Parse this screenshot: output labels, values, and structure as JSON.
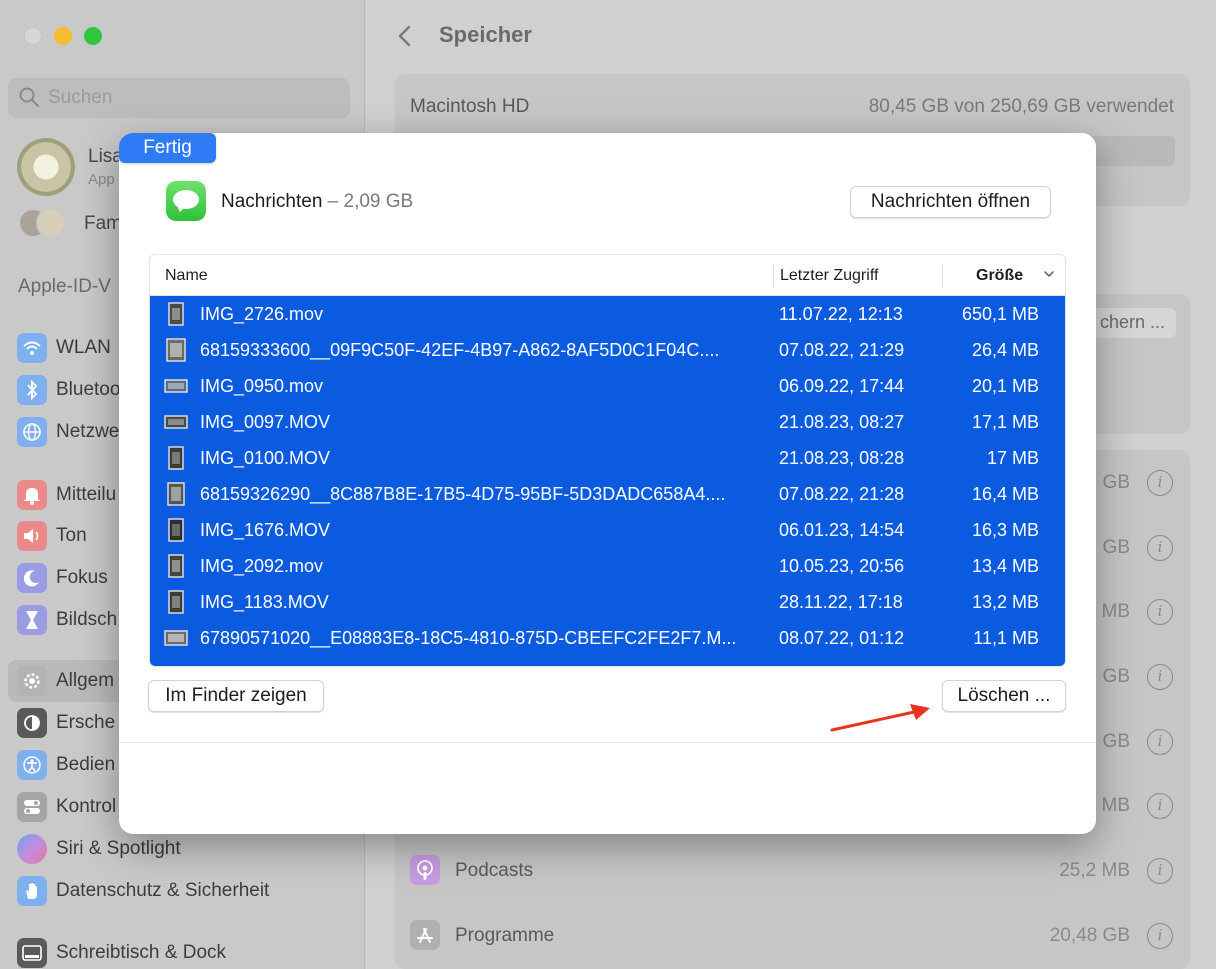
{
  "sidebar": {
    "search_placeholder": "Suchen",
    "account_name": "Lisa",
    "account_sub": "App",
    "family_label": "Fam",
    "section_label": "Apple-ID-V",
    "items": [
      {
        "label": "WLAN",
        "icon": "wifi-icon",
        "color": "#3d8bf0"
      },
      {
        "label": "Bluetoo",
        "icon": "bluetooth-icon",
        "color": "#3d8bf0"
      },
      {
        "label": "Netzwe",
        "icon": "globe-icon",
        "color": "#3d8bf0"
      },
      {
        "label": "Mitteilu",
        "icon": "bell-icon",
        "color": "#ef4f4f"
      },
      {
        "label": "Ton",
        "icon": "speaker-icon",
        "color": "#ef4f4f"
      },
      {
        "label": "Fokus",
        "icon": "moon-icon",
        "color": "#5b5fd6"
      },
      {
        "label": "Bildsch",
        "icon": "hourglass-icon",
        "color": "#5b5fd6"
      },
      {
        "label": "Allgem",
        "icon": "gear-icon",
        "color": "#8e8e93"
      },
      {
        "label": "Ersche",
        "icon": "appearance-icon",
        "color": "#1d1d1d"
      },
      {
        "label": "Bedien",
        "icon": "accessibility-icon",
        "color": "#3d8bf0"
      },
      {
        "label": "Kontrol",
        "icon": "control-center-icon",
        "color": "#8e8e93"
      },
      {
        "label": "Siri & Spotlight",
        "icon": "siri-icon",
        "color": "#7a4fe0"
      },
      {
        "label": "Datenschutz & Sicherheit",
        "icon": "hand-icon",
        "color": "#3d8bf0"
      },
      {
        "label": "Schreibtisch & Dock",
        "icon": "dock-icon",
        "color": "#1d1d1d"
      }
    ]
  },
  "content": {
    "title": "Speicher",
    "disk_name": "Macintosh HD",
    "disk_usage": "80,45 GB von 250,69 GB verwendet",
    "partial_button": "chern ...",
    "row_sizes": [
      "GB",
      "GB",
      "MB",
      "GB",
      "GB",
      "MB"
    ],
    "categories": [
      {
        "label": "Podcasts",
        "size": "25,2 MB",
        "icon": "podcasts-icon",
        "color": "#b569e0"
      },
      {
        "label": "Programme",
        "size": "20,48 GB",
        "icon": "app-store-icon",
        "color": "#9a9a9a"
      }
    ]
  },
  "modal": {
    "app_name": "Nachrichten",
    "app_size": "– 2,09 GB",
    "open_button": "Nachrichten öffnen",
    "columns": {
      "name": "Name",
      "last_access": "Letzter Zugriff",
      "size": "Größe"
    },
    "files": [
      {
        "name": "IMG_2726.mov",
        "date": "11.07.22, 12:13",
        "size": "650,1 MB"
      },
      {
        "name": "68159333600__09F9C50F-42EF-4B97-A862-8AF5D0C1F04C....",
        "date": "07.08.22, 21:29",
        "size": "26,4 MB"
      },
      {
        "name": "IMG_0950.mov",
        "date": "06.09.22, 17:44",
        "size": "20,1 MB"
      },
      {
        "name": "IMG_0097.MOV",
        "date": "21.08.23, 08:27",
        "size": "17,1 MB"
      },
      {
        "name": "IMG_0100.MOV",
        "date": "21.08.23, 08:28",
        "size": "17 MB"
      },
      {
        "name": "68159326290__8C887B8E-17B5-4D75-95BF-5D3DADC658A4....",
        "date": "07.08.22, 21:28",
        "size": "16,4 MB"
      },
      {
        "name": "IMG_1676.MOV",
        "date": "06.01.23, 14:54",
        "size": "16,3 MB"
      },
      {
        "name": "IMG_2092.mov",
        "date": "10.05.23, 20:56",
        "size": "13,4 MB"
      },
      {
        "name": "IMG_1183.MOV",
        "date": "28.11.22, 17:18",
        "size": "13,2 MB"
      },
      {
        "name": "67890571020__E08883E8-18C5-4810-875D-CBEEFC2FE2F7.M...",
        "date": "08.07.22, 01:12",
        "size": "11,1 MB"
      }
    ],
    "finder_button": "Im Finder zeigen",
    "delete_button": "Löschen ...",
    "done_button": "Fertig"
  },
  "colors": {
    "selection": "#0a5be0",
    "accent": "#2f7bf5",
    "annotation_arrow": "#e8341f"
  }
}
